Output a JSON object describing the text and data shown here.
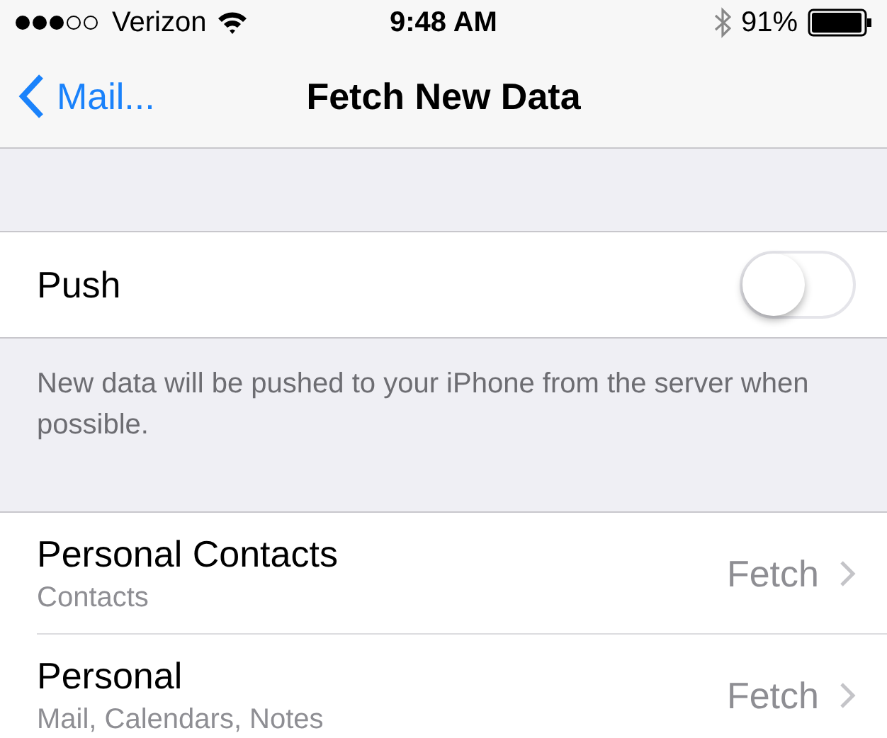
{
  "status_bar": {
    "carrier": "Verizon",
    "time": "9:48 AM",
    "battery": "91%"
  },
  "nav": {
    "back": "Mail...",
    "title": "Fetch New Data"
  },
  "push": {
    "label": "Push",
    "on": false,
    "footer": "New data will be pushed to your iPhone from the server when possible."
  },
  "accounts": [
    {
      "name": "Personal Contacts",
      "detail": "Contacts",
      "value": "Fetch"
    },
    {
      "name": "Personal",
      "detail": "Mail, Calendars, Notes",
      "value": "Fetch"
    }
  ]
}
